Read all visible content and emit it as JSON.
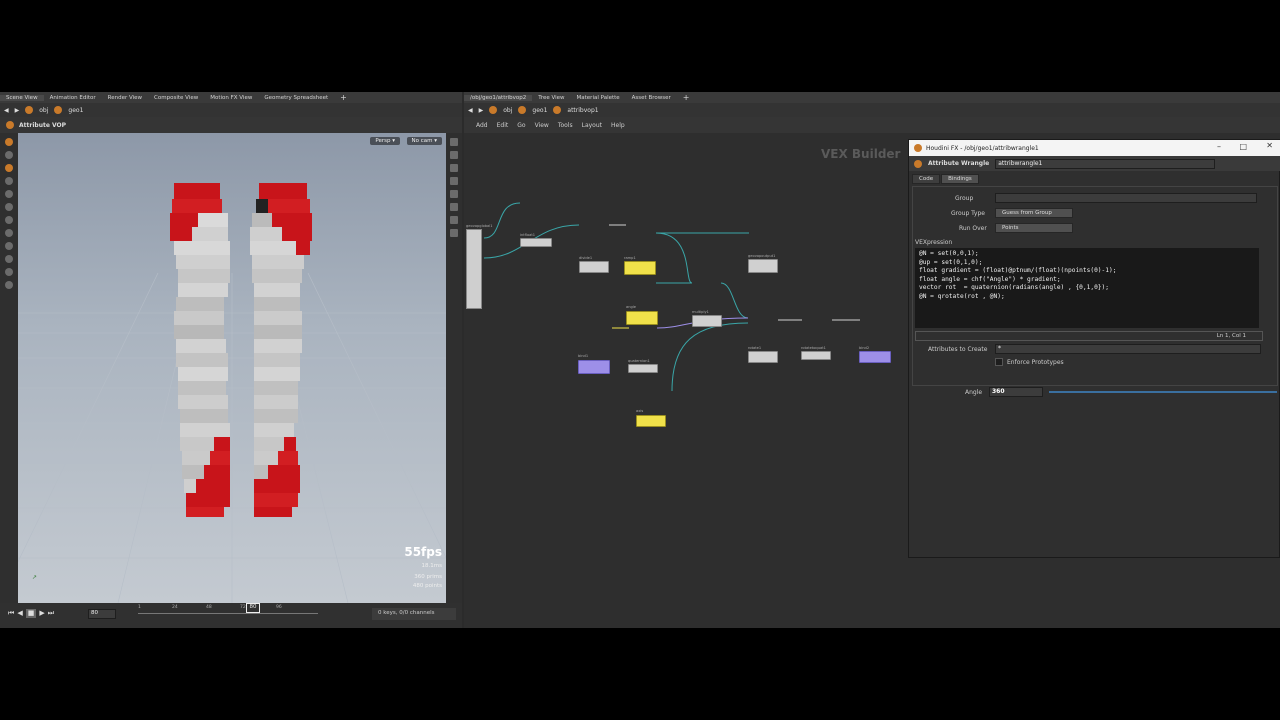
{
  "left_tabs": [
    "Scene View",
    "Animation Editor",
    "Render View",
    "Composite View",
    "Motion FX View",
    "Geometry Spreadsheet"
  ],
  "right_tabs": [
    "/obj/geo1/attribvop2",
    "Tree View",
    "Material Palette",
    "Asset Browser"
  ],
  "left_path": {
    "obj": "obj",
    "geo": "geo1"
  },
  "right_path": {
    "obj": "obj",
    "geo": "geo1",
    "vop": "attribvop1"
  },
  "viewport": {
    "title": "Attribute VOP",
    "persp": "Persp",
    "cam": "No cam",
    "fps": "55fps",
    "ms": "18.1ms",
    "prims": "360  prims",
    "points": "480  points"
  },
  "timeline": {
    "frame": "80",
    "current": "80",
    "ticks": [
      "1",
      "24",
      "48",
      "72",
      "96"
    ],
    "keys": "0 keys, 0/0 channels"
  },
  "menu": [
    "Add",
    "Edit",
    "Go",
    "View",
    "Tools",
    "Layout",
    "Help"
  ],
  "network": {
    "watermark": "VEX Builder",
    "nodes": [
      {
        "label": "geovopglobal1",
        "kind": "gray"
      },
      {
        "label": "intfloat1",
        "kind": "gray"
      },
      {
        "label": "divide1",
        "kind": "gray"
      },
      {
        "label": "ramp1",
        "kind": "yellow"
      },
      {
        "label": "geovopoutput1",
        "kind": "gray"
      },
      {
        "label": "angle",
        "kind": "yellow"
      },
      {
        "label": "multiply1",
        "kind": "gray"
      },
      {
        "label": "bind1",
        "kind": "purple"
      },
      {
        "label": "quaternion1",
        "kind": "gray"
      },
      {
        "label": "rotate1",
        "kind": "gray"
      },
      {
        "label": "rotatetoquat1",
        "kind": "gray"
      },
      {
        "label": "bind2",
        "kind": "purple"
      },
      {
        "label": "axis",
        "kind": "yellow"
      }
    ]
  },
  "float_window": {
    "title": "Houdini FX - /obj/geo1/attribwrangle1",
    "node_type": "Attribute Wrangle",
    "node_name": "attribwrangle1",
    "tabs": [
      "Code",
      "Bindings"
    ],
    "group_label": "Group",
    "group_type_label": "Group Type",
    "group_type_value": "Guess from Group",
    "run_over_label": "Run Over",
    "run_over_value": "Points",
    "vexpression_label": "VEXpression",
    "code_lines": [
      "@N = set(0,0,1);",
      "@up = set(0,1,0);",
      "",
      "float gradient = (float)@ptnum/(float)(npoints(0)-1);",
      "float angle = chf(\"Angle\") * gradient;",
      "vector rot  = quaternion(radians(angle) , {0,1,0});",
      "",
      "@N = qrotate(rot , @N);"
    ],
    "cursor_pos": "Ln 1, Col 1",
    "attrs_label": "Attributes to Create",
    "attrs_value": "*",
    "enforce_label": "Enforce Prototypes",
    "angle_label": "Angle",
    "angle_value": "360"
  },
  "colors": {
    "accent_red": "#c8141a",
    "node_yellow": "#f0e14a",
    "node_purple": "#9d8fe8",
    "wire_cyan": "#3aa6a8"
  }
}
